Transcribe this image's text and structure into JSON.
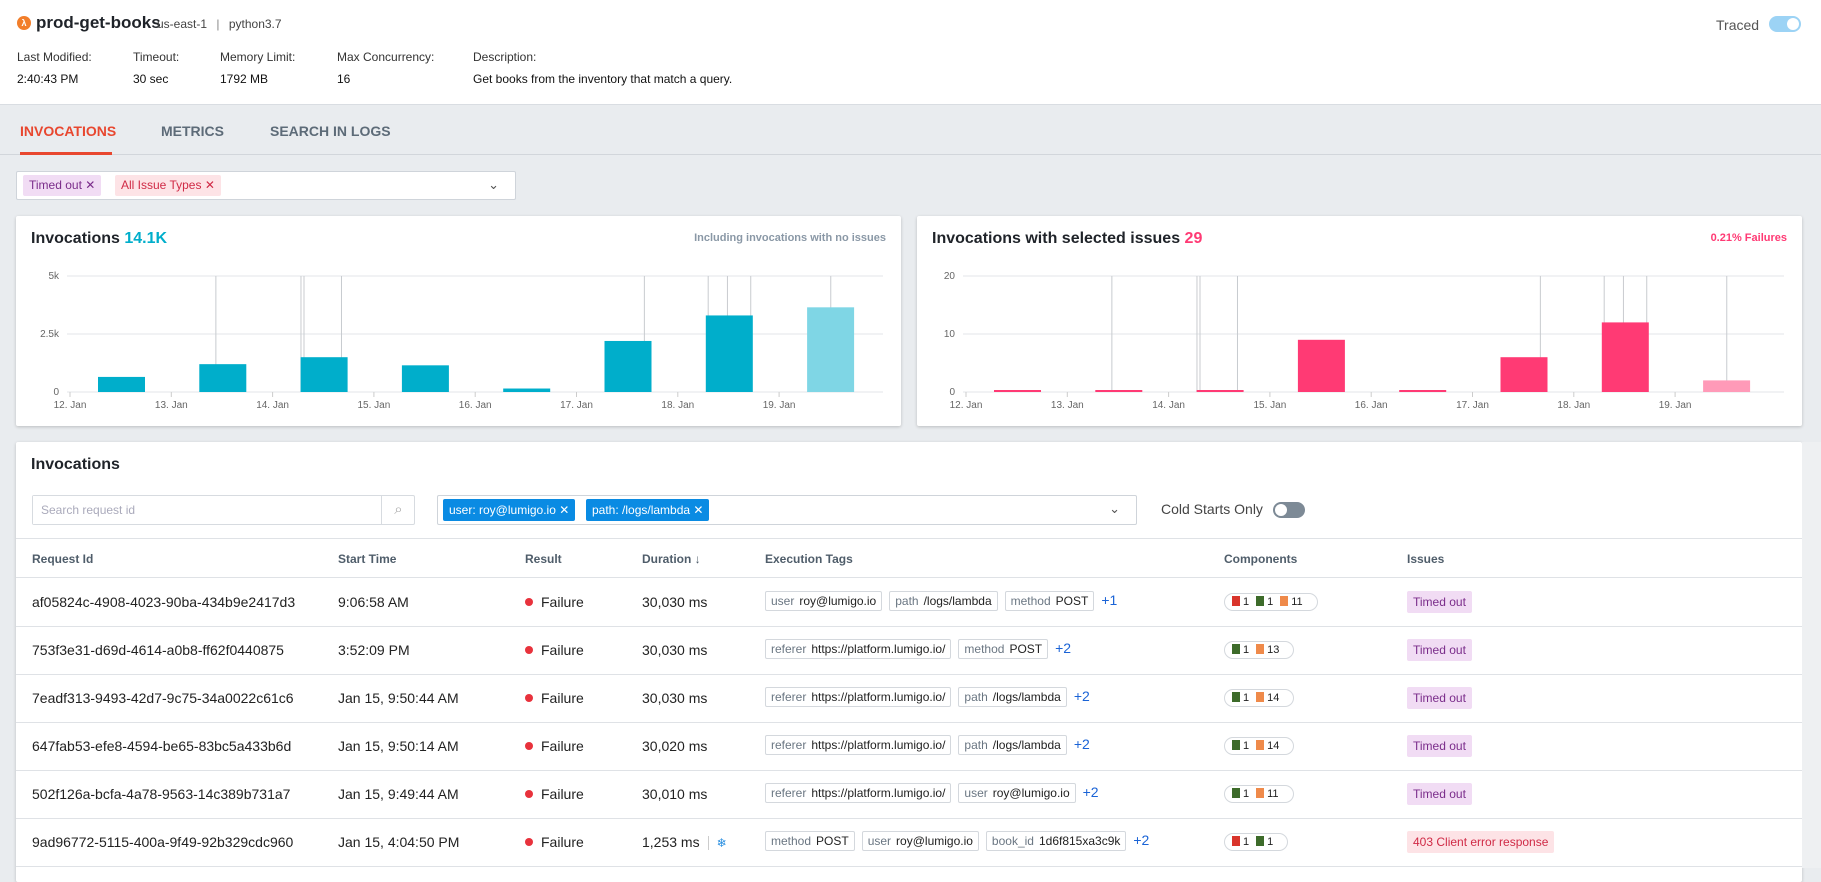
{
  "header": {
    "function_name": "prod-get-books",
    "region": "us-east-1",
    "runtime": "python3.7",
    "separator": "|",
    "meta": [
      {
        "label": "Last Modified:",
        "value": "2:40:43 PM"
      },
      {
        "label": "Timeout:",
        "value": "30 sec"
      },
      {
        "label": "Memory Limit:",
        "value": "1792 MB"
      },
      {
        "label": "Max Concurrency:",
        "value": "16"
      },
      {
        "label": "Description:",
        "value": "Get books from the inventory that match a query."
      }
    ],
    "traced_label": "Traced",
    "traced_on": true
  },
  "tabs": [
    {
      "label": "INVOCATIONS",
      "active": true
    },
    {
      "label": "METRICS"
    },
    {
      "label": "SEARCH IN LOGS"
    }
  ],
  "issue_filter": {
    "chips": [
      "Timed out",
      "All Issue Types"
    ]
  },
  "colors": {
    "accent": "#e8472f",
    "invocations": "#00aecb",
    "issues": "#ff3a74",
    "chip_blue": "#0a8be3"
  },
  "chart_data": [
    {
      "type": "bar",
      "title": "Invocations",
      "total": "14.1K",
      "subtitle": "Including invocations with no issues",
      "categories": [
        "12. Jan",
        "13. Jan",
        "14. Jan",
        "15. Jan",
        "16. Jan",
        "17. Jan",
        "18. Jan",
        "19. Jan"
      ],
      "values": [
        650,
        1200,
        1500,
        1150,
        150,
        2200,
        3300,
        3650
      ],
      "last_partial": true,
      "yticks": [
        "0",
        "2.5k",
        "5k"
      ],
      "ylim": [
        0,
        5000
      ],
      "grid": true
    },
    {
      "type": "bar",
      "title": "Invocations with selected issues",
      "total": "29",
      "subtitle": "0.21% Failures",
      "categories": [
        "12. Jan",
        "13. Jan",
        "14. Jan",
        "15. Jan",
        "16. Jan",
        "17. Jan",
        "18. Jan",
        "19. Jan"
      ],
      "values": [
        0,
        0,
        0,
        9,
        0,
        6,
        12,
        2
      ],
      "last_partial": true,
      "yticks": [
        "0",
        "10",
        "20"
      ],
      "ylim": [
        0,
        20
      ],
      "grid": true
    }
  ],
  "invocations": {
    "title": "Invocations",
    "search_placeholder": "Search request id",
    "tag_filters": [
      "user: roy@lumigo.io",
      "path: /logs/lambda"
    ],
    "cold_starts_label": "Cold Starts Only",
    "cold_starts_on": false,
    "columns": [
      "Request Id",
      "Start Time",
      "Result",
      "Duration ↓",
      "Execution Tags",
      "Components",
      "Issues"
    ],
    "rows": [
      {
        "id": "af05824c-4908-4023-90ba-434b9e2417d3",
        "start": "9:06:58 AM",
        "result": "Failure",
        "duration": "30,030 ms",
        "cold": false,
        "tags": [
          [
            "user",
            "roy@lumigo.io"
          ],
          [
            "path",
            "/logs/lambda"
          ],
          [
            "method",
            "POST"
          ]
        ],
        "more": "+1",
        "components": [
          [
            "bucket-icon",
            "1"
          ],
          [
            "gateway-icon",
            "1"
          ],
          [
            "log-icon",
            "11"
          ]
        ],
        "issue": "Timed out",
        "issue_type": "timeout"
      },
      {
        "id": "753f3e31-d69d-4614-a0b8-ff62f0440875",
        "start": "3:52:09 PM",
        "result": "Failure",
        "duration": "30,030 ms",
        "cold": false,
        "tags": [
          [
            "referer",
            "https://platform.lumigo.io/"
          ],
          [
            "method",
            "POST"
          ]
        ],
        "more": "+2",
        "components": [
          [
            "gateway-icon",
            "1"
          ],
          [
            "log-icon",
            "13"
          ]
        ],
        "issue": "Timed out",
        "issue_type": "timeout"
      },
      {
        "id": "7eadf313-9493-42d7-9c75-34a0022c61c6",
        "start": "Jan 15, 9:50:44 AM",
        "result": "Failure",
        "duration": "30,030 ms",
        "cold": false,
        "tags": [
          [
            "referer",
            "https://platform.lumigo.io/"
          ],
          [
            "path",
            "/logs/lambda"
          ]
        ],
        "more": "+2",
        "components": [
          [
            "gateway-icon",
            "1"
          ],
          [
            "log-icon",
            "14"
          ]
        ],
        "issue": "Timed out",
        "issue_type": "timeout"
      },
      {
        "id": "647fab53-efe8-4594-be65-83bc5a433b6d",
        "start": "Jan 15, 9:50:14 AM",
        "result": "Failure",
        "duration": "30,020 ms",
        "cold": false,
        "tags": [
          [
            "referer",
            "https://platform.lumigo.io/"
          ],
          [
            "path",
            "/logs/lambda"
          ]
        ],
        "more": "+2",
        "components": [
          [
            "gateway-icon",
            "1"
          ],
          [
            "log-icon",
            "14"
          ]
        ],
        "issue": "Timed out",
        "issue_type": "timeout"
      },
      {
        "id": "502f126a-bcfa-4a78-9563-14c389b731a7",
        "start": "Jan 15, 9:49:44 AM",
        "result": "Failure",
        "duration": "30,010 ms",
        "cold": false,
        "tags": [
          [
            "referer",
            "https://platform.lumigo.io/"
          ],
          [
            "user",
            "roy@lumigo.io"
          ]
        ],
        "more": "+2",
        "components": [
          [
            "gateway-icon",
            "1"
          ],
          [
            "log-icon",
            "11"
          ]
        ],
        "issue": "Timed out",
        "issue_type": "timeout"
      },
      {
        "id": "9ad96772-5115-400a-9f49-92b329cdc960",
        "start": "Jan 15, 4:04:50 PM",
        "result": "Failure",
        "duration": "1,253 ms",
        "cold": true,
        "tags": [
          [
            "method",
            "POST"
          ],
          [
            "user",
            "roy@lumigo.io"
          ],
          [
            "book_id",
            "1d6f815xa3c9k"
          ]
        ],
        "more": "+2",
        "components": [
          [
            "bucket-icon",
            "1"
          ],
          [
            "gateway-icon",
            "1"
          ]
        ],
        "issue": "403 Client error response",
        "issue_type": "error"
      }
    ]
  }
}
